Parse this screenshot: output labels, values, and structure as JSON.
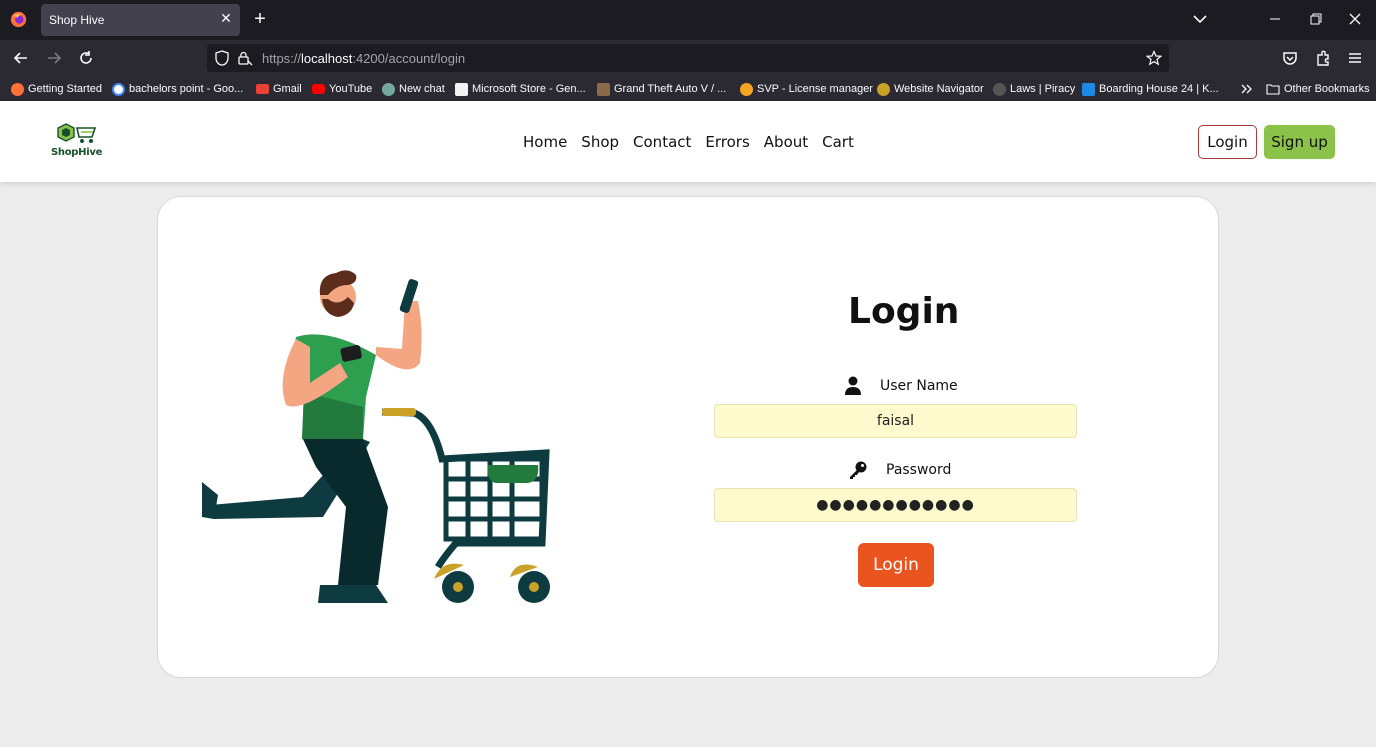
{
  "browser": {
    "tab_title": "Shop Hive",
    "url_prefix": "https://",
    "url_host": "localhost",
    "url_rest": ":4200/account/login",
    "bookmarks": [
      "Getting Started",
      "bachelors point - Goo...",
      "Gmail",
      "YouTube",
      "New chat",
      "Microsoft Store - Gen...",
      "Grand Theft Auto V / ...",
      "SVP - License manager",
      "Website Navigator",
      "Laws | Piracy",
      "Boarding House 24 | K...",
      "Other Bookmarks"
    ]
  },
  "site": {
    "logo_text": "ShopHive",
    "nav": [
      "Home",
      "Shop",
      "Contact",
      "Errors",
      "About",
      "Cart"
    ],
    "login_button": "Login",
    "signup_button": "Sign up"
  },
  "login": {
    "title": "Login",
    "username_label": "User Name",
    "username_value": "faisal",
    "password_label": "Password",
    "password_value": "●●●●●●●●●●●●",
    "submit_label": "Login"
  },
  "colors": {
    "accent_green": "#8bc34a",
    "submit_orange": "#e9541f",
    "autofill_yellow": "#fffacd"
  }
}
